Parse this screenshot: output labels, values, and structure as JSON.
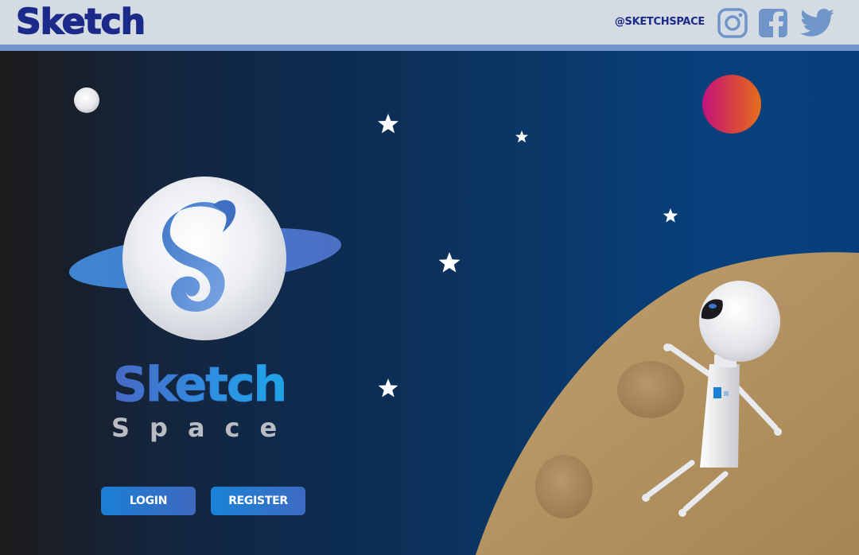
{
  "header": {
    "brand": "Sketch",
    "handle": "@SKETCHSPACE",
    "social": [
      {
        "name": "instagram",
        "icon": "instagram-icon"
      },
      {
        "name": "facebook",
        "icon": "facebook-icon"
      },
      {
        "name": "twitter",
        "icon": "twitter-icon"
      }
    ]
  },
  "hero": {
    "logo_word": "Sketch",
    "logo_sub": "Space",
    "logo_icon": "snake-s-planet-logo",
    "buttons": {
      "login": "LOGIN",
      "register": "REGISTER"
    },
    "illustration": "astronaut-on-planet"
  },
  "colors": {
    "brand_navy": "#1c2a8a",
    "header_bg": "#d5dbe2",
    "header_rule": "#6f95c9",
    "sky_dark": "#1d1b1c",
    "sky_blue": "#073f7d",
    "planet_tan": "#b08f5e",
    "button_blue": "#1a7fd4",
    "logo_gray": "#b9bcc2"
  }
}
